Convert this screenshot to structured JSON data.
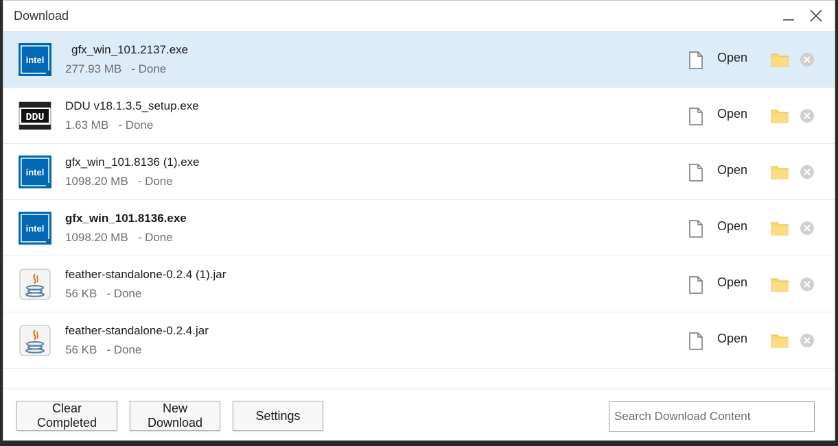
{
  "window": {
    "title": "Download"
  },
  "downloads": [
    {
      "name": "gfx_win_101.2137.exe",
      "size": "277.93 MB",
      "status": "- Done",
      "icon": "intel-icon",
      "selected": true,
      "bold": false
    },
    {
      "name": "DDU v18.1.3.5_setup.exe",
      "size": "1.63 MB",
      "status": "- Done",
      "icon": "ddu-icon",
      "selected": false,
      "bold": false
    },
    {
      "name": "gfx_win_101.8136 (1).exe",
      "size": "1098.20 MB",
      "status": "- Done",
      "icon": "intel-icon",
      "selected": false,
      "bold": false
    },
    {
      "name": "gfx_win_101.8136.exe",
      "size": "1098.20 MB",
      "status": "- Done",
      "icon": "intel-icon",
      "selected": false,
      "bold": true
    },
    {
      "name": "feather-standalone-0.2.4 (1).jar",
      "size": "56 KB",
      "status": "- Done",
      "icon": "java-icon",
      "selected": false,
      "bold": false
    },
    {
      "name": "feather-standalone-0.2.4.jar",
      "size": "56 KB",
      "status": "- Done",
      "icon": "java-icon",
      "selected": false,
      "bold": false
    }
  ],
  "row_actions": {
    "open_label": "Open"
  },
  "footer": {
    "clear_label": "Clear Completed",
    "new_label": "New Download",
    "settings_label": "Settings",
    "search_placeholder": "Search Download Content"
  },
  "colors": {
    "selected_row": "#dcecf9",
    "intel_blue": "#0068b5",
    "folder_yellow": "#f8d775"
  }
}
